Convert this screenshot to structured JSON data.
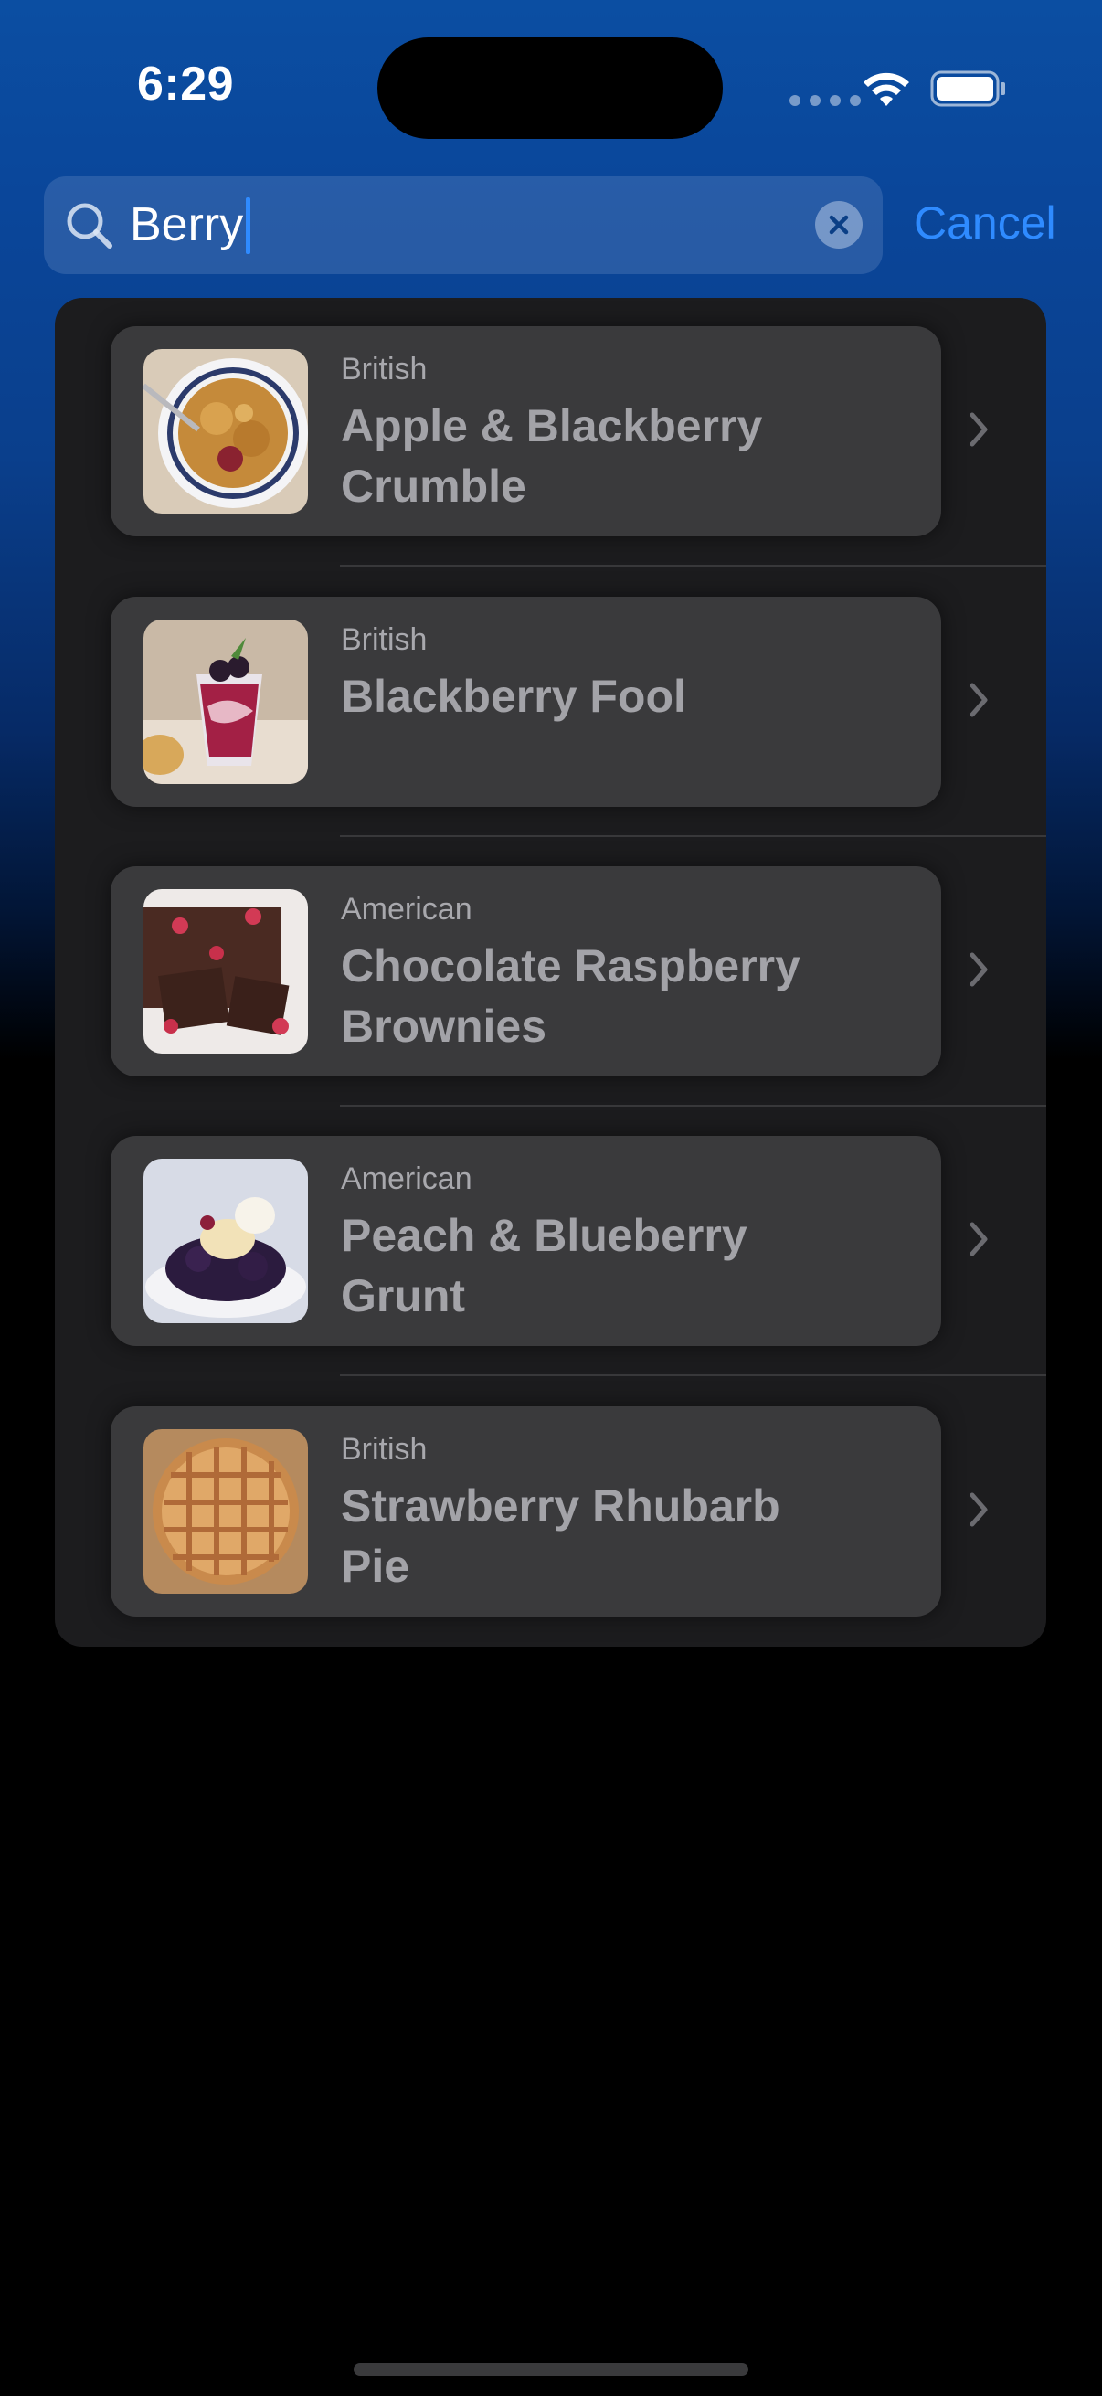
{
  "status_bar": {
    "time": "6:29"
  },
  "search": {
    "query": "Berry",
    "cancel_label": "Cancel"
  },
  "colors": {
    "accent": "#2f8bff",
    "card_bg": "#3a3a3c",
    "panel_bg": "#1c1c1e",
    "header_blue": "#0b4ea2"
  },
  "results": [
    {
      "cuisine": "British",
      "title": "Apple & Blackberry Crumble",
      "thumbnail": "crumble-image"
    },
    {
      "cuisine": "British",
      "title": "Blackberry Fool",
      "thumbnail": "fool-image"
    },
    {
      "cuisine": "American",
      "title": "Chocolate Raspberry Brownies",
      "thumbnail": "brownies-image"
    },
    {
      "cuisine": "American",
      "title": "Peach & Blueberry Grunt",
      "thumbnail": "grunt-image"
    },
    {
      "cuisine": "British",
      "title": "Strawberry Rhubarb Pie",
      "thumbnail": "pie-image"
    }
  ]
}
